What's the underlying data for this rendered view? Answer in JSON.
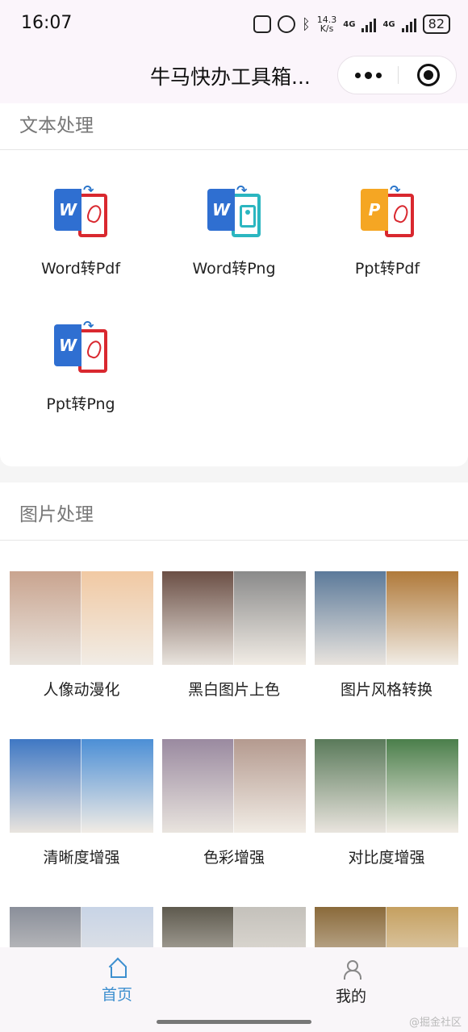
{
  "status_bar": {
    "time": "16:07",
    "speed_top": "14.3",
    "speed_bottom": "K/s",
    "lte1": "4G",
    "lte2": "4G",
    "battery": "82"
  },
  "header": {
    "title": "牛马快办工具箱..."
  },
  "text_section": {
    "title": "文本处理",
    "tools": [
      {
        "label": "Word转Pdf",
        "letter": "W",
        "front_color": "#2f6fd1",
        "target": "pdf"
      },
      {
        "label": "Word转Png",
        "letter": "W",
        "front_color": "#2f6fd1",
        "target": "img"
      },
      {
        "label": "Ppt转Pdf",
        "letter": "P",
        "front_color": "#f5a623",
        "target": "pdf"
      },
      {
        "label": "Ppt转Png",
        "letter": "W",
        "front_color": "#2f6fd1",
        "target": "pdf"
      }
    ]
  },
  "image_section": {
    "title": "图片处理",
    "items": [
      {
        "label": "人像动漫化",
        "left": "#c9a48f",
        "right": "#f1c9a3"
      },
      {
        "label": "黑白图片上色",
        "left": "#6b4f45",
        "right": "#8a8a8a"
      },
      {
        "label": "图片风格转换",
        "left": "#5c7a9a",
        "right": "#b07a3a"
      },
      {
        "label": "清晰度增强",
        "left": "#3f78c4",
        "right": "#4c8fd6"
      },
      {
        "label": "色彩增强",
        "left": "#9a8aa0",
        "right": "#b49a8f"
      },
      {
        "label": "对比度增强",
        "left": "#5a7a5a",
        "right": "#4b7f4b"
      },
      {
        "label": "",
        "left": "#8a8f9a",
        "right": "#c8d4e6"
      },
      {
        "label": "",
        "left": "#5e5a4e",
        "right": "#c4c1bb"
      },
      {
        "label": "",
        "left": "#8a6a3a",
        "right": "#c5a060"
      }
    ]
  },
  "tab_bar": {
    "home_label": "首页",
    "mine_label": "我的"
  },
  "watermark": "@掘金社区"
}
